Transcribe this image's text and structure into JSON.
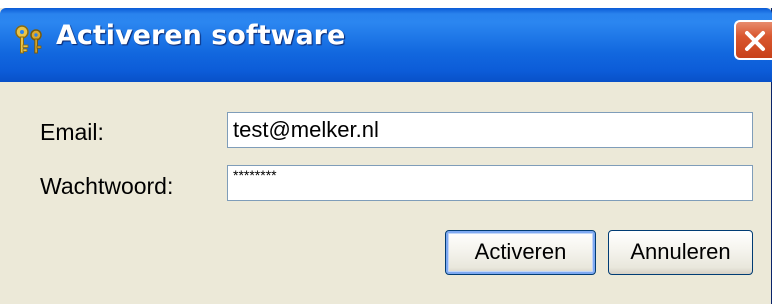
{
  "dialog": {
    "title": "Activeren software",
    "title_icon": "keys-icon",
    "close_icon": "close-icon"
  },
  "form": {
    "email_label": "Email:",
    "email_value": "test@melker.nl",
    "password_label": "Wachtwoord:",
    "password_value": "********"
  },
  "buttons": {
    "activate_label": "Activeren",
    "cancel_label": "Annuleren"
  },
  "colors": {
    "titlebar": "#0a5bd6",
    "dialog_background": "#ece9d8",
    "close_button": "#d9572f",
    "input_border": "#7f9db9",
    "button_border": "#003c74"
  }
}
